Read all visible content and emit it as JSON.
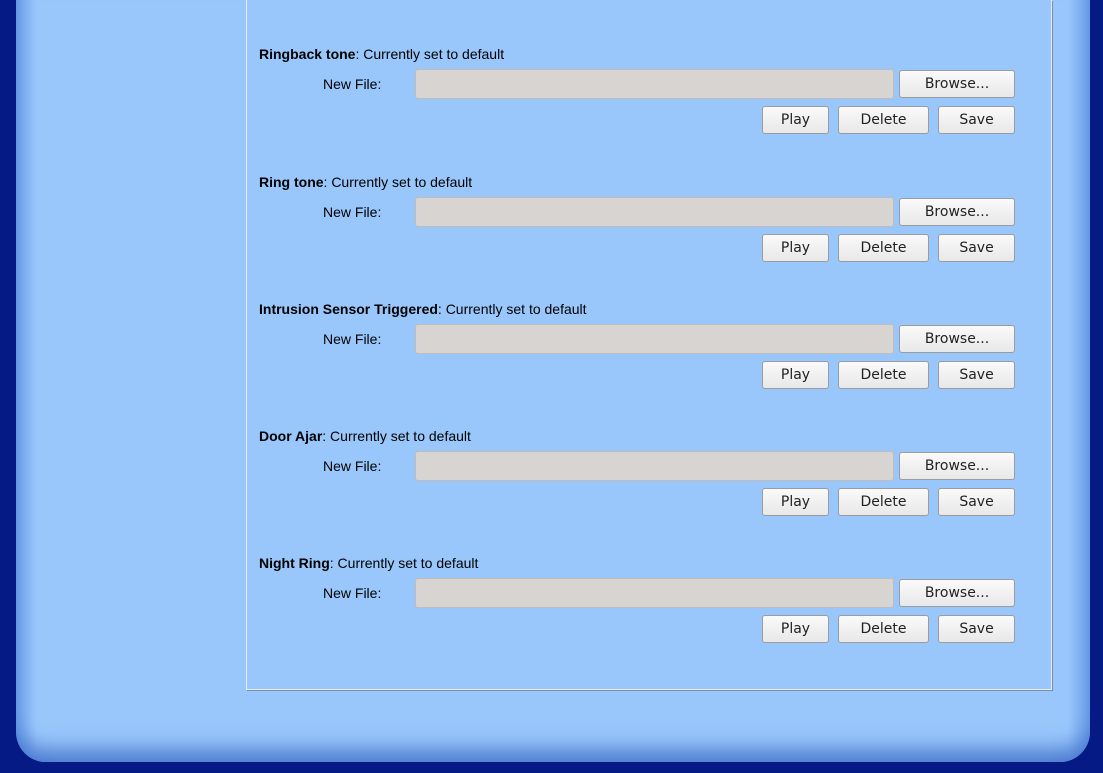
{
  "sections": [
    {
      "name": "Ringback tone",
      "status": ": Currently set to default"
    },
    {
      "name": "Ring tone",
      "status": ": Currently set to default"
    },
    {
      "name": "Intrusion Sensor Triggered",
      "status": ": Currently set to default"
    },
    {
      "name": "Door Ajar",
      "status": ": Currently set to default"
    },
    {
      "name": "Night Ring",
      "status": ": Currently set to default"
    }
  ],
  "labels": {
    "new_file": "New File:",
    "browse": "Browse...",
    "play": "Play",
    "delete": "Delete",
    "save": "Save"
  }
}
